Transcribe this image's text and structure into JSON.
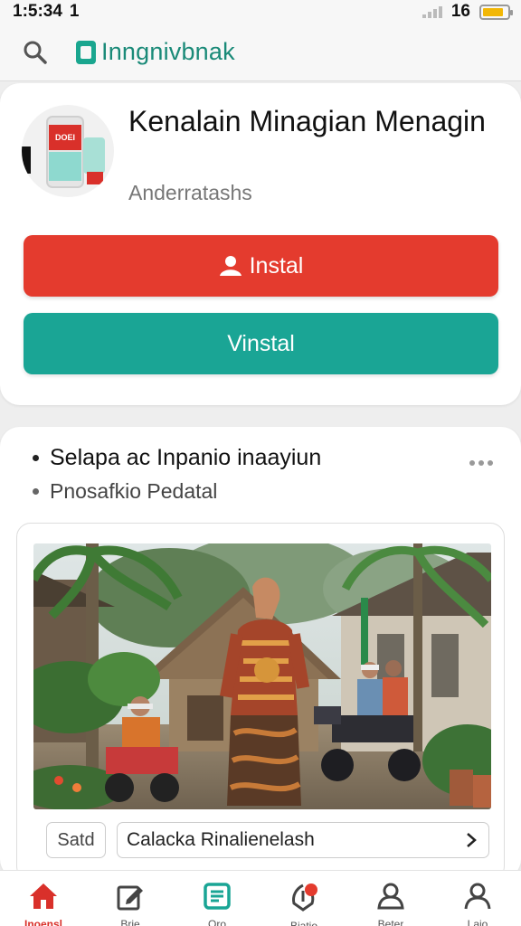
{
  "status_bar": {
    "time": "1:5:34",
    "extra_digit": "1",
    "signal_label": "16",
    "battery_level": 0.85
  },
  "app_bar": {
    "brand": "Inngnivbnak",
    "icons": [
      "search-icon",
      "brand-logo-icon"
    ]
  },
  "app_card": {
    "icon_screen_text": "DOEI",
    "title": "Kenalain Minagian Menagin",
    "subtitle": "Anderratashs",
    "install_label": "Instal",
    "vinstal_label": "Vinstal"
  },
  "post": {
    "line1": "Selapa ac Inpanio inaayiun",
    "line2": "Pnosafkio Pedatal",
    "chip": "Satd",
    "link": "Calacka Rinalienelash",
    "photo": "village street with thatched hut, palm trees, woman in batik dress, men on motorbikes"
  },
  "bottom_nav": {
    "items": [
      {
        "label": "Inoensl",
        "icon": "home-icon"
      },
      {
        "label": "Brie",
        "icon": "edit-icon"
      },
      {
        "label": "Oro",
        "icon": "document-icon"
      },
      {
        "label": "Biatio",
        "icon": "notification-icon"
      },
      {
        "label": "Beter",
        "icon": "people-icon"
      },
      {
        "label": "Laio",
        "icon": "profile-icon"
      }
    ],
    "colors": {
      "active": "#d9302a",
      "accent": "#1aa595"
    }
  }
}
